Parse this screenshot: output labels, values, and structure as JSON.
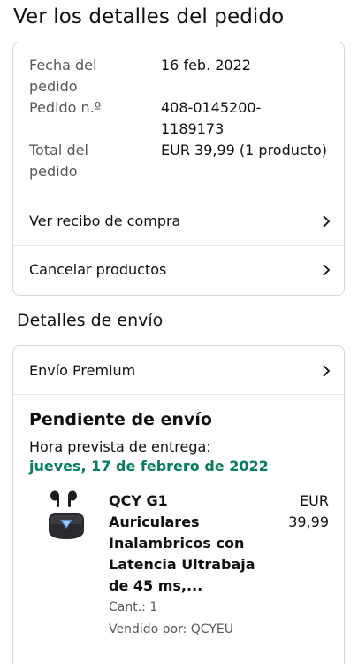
{
  "page": {
    "title": "Ver los detalles del pedido"
  },
  "order": {
    "date_label_1": "Fecha del",
    "date_label_2": "pedido",
    "date_value": "16 feb. 2022",
    "number_label": "Pedido n.º",
    "number_value_1": "408-0145200-",
    "number_value_2": "1189173",
    "total_label_1": "Total del",
    "total_label_2": "pedido",
    "total_value": "EUR 39,99 (1 producto)"
  },
  "actions": {
    "receipt": "Ver recibo de compra",
    "cancel": "Cancelar productos"
  },
  "shipping": {
    "section_title": "Detalles de envío",
    "method": "Envío Premium",
    "status": "Pendiente de envío",
    "delivery_label": "Hora prevista de entrega:",
    "delivery_date": "jueves, 17 de febrero de 2022",
    "accent_color": "#067d62"
  },
  "product": {
    "title_lines": [
      "QCY G1",
      "Auriculares",
      "Inalambricos con",
      "Latencia Ultrabaja",
      "de 45 ms,..."
    ],
    "price_currency": "EUR",
    "price_value": "39,99",
    "quantity": "Cant.: 1",
    "seller": "Vendido por: QCYEU",
    "image_icon": "earbuds-icon"
  }
}
